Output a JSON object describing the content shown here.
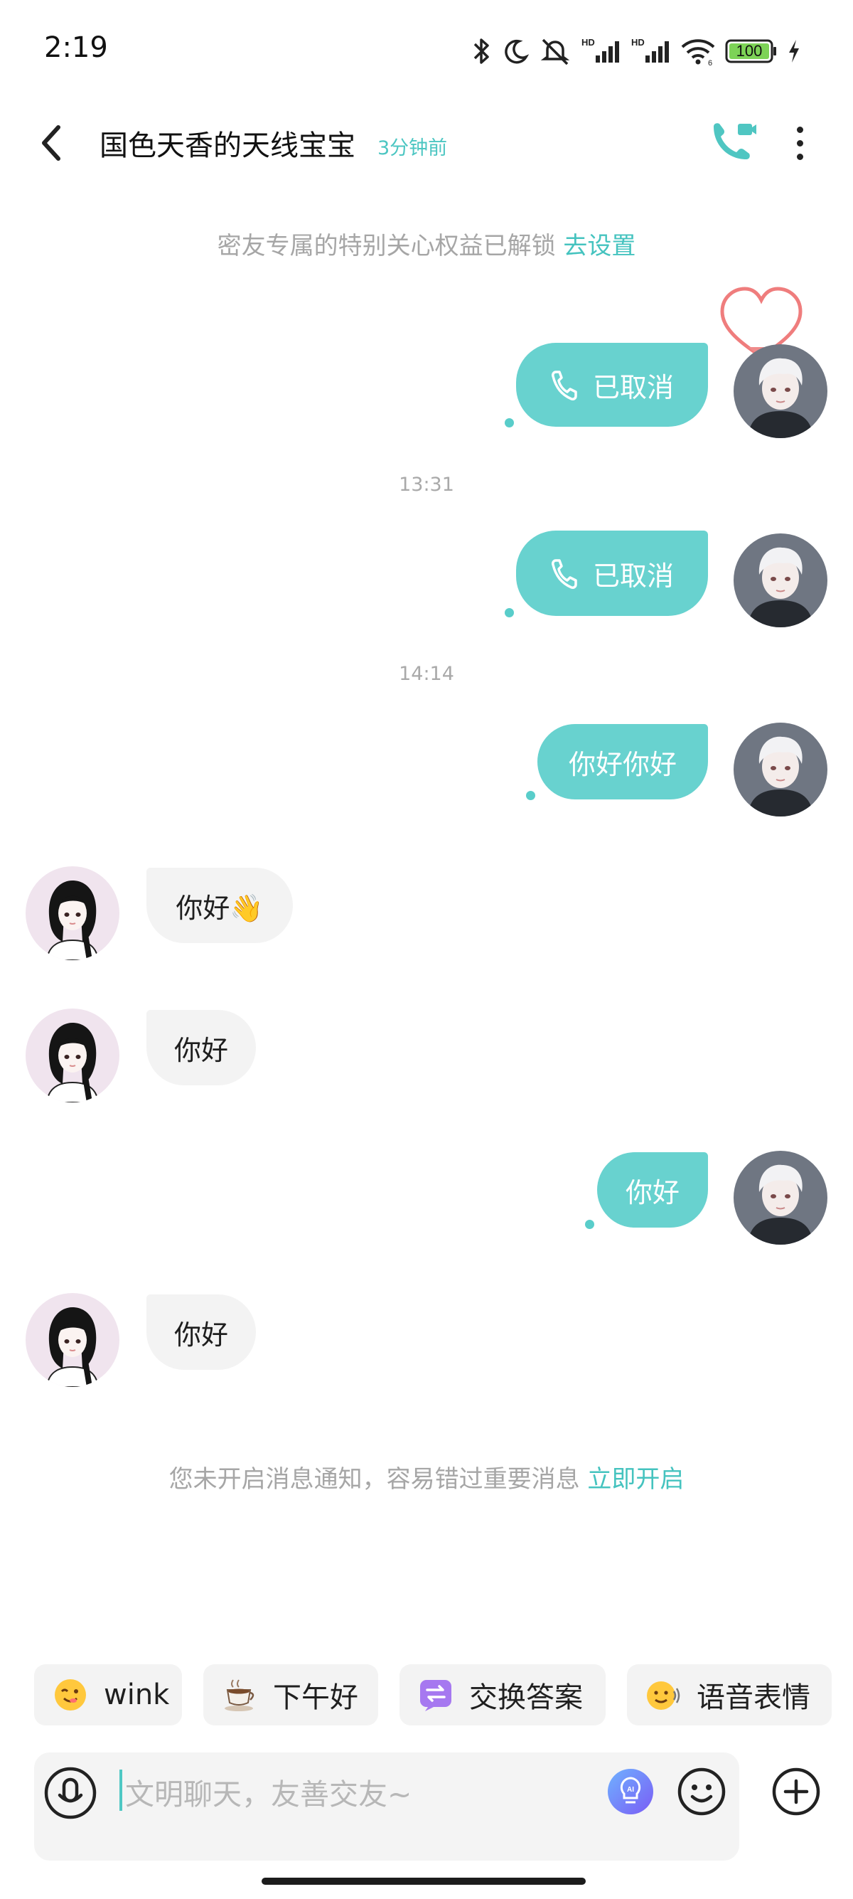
{
  "status_bar": {
    "time": "2:19",
    "battery": "100",
    "icons": [
      "bluetooth-icon",
      "moon-icon",
      "mute-icon",
      "hd-signal-icon",
      "hd-signal-icon",
      "wifi-icon",
      "battery-icon",
      "charging-icon"
    ]
  },
  "header": {
    "title": "国色天香的天线宝宝",
    "last_seen": "3分钟前"
  },
  "notices": {
    "special_care": "密友专属的特别关心权益已解锁",
    "special_care_link": "去设置",
    "notification": "您未开启消息通知，容易错过重要消息",
    "notification_link": "立即开启"
  },
  "messages": [
    {
      "side": "out",
      "type": "call",
      "text": "已取消"
    },
    {
      "type": "time",
      "text": "13:31"
    },
    {
      "side": "out",
      "type": "call",
      "text": "已取消"
    },
    {
      "type": "time",
      "text": "14:14"
    },
    {
      "side": "out",
      "type": "text",
      "text": "你好你好"
    },
    {
      "side": "in",
      "type": "text",
      "text": "你好👋"
    },
    {
      "side": "in",
      "type": "text",
      "text": "你好"
    },
    {
      "side": "out",
      "type": "text",
      "text": "你好"
    },
    {
      "side": "in",
      "type": "text",
      "text": "你好"
    }
  ],
  "quick_replies": [
    {
      "label": "wink",
      "icon": "wink-emoji-icon"
    },
    {
      "label": "下午好",
      "icon": "coffee-icon"
    },
    {
      "label": "交换答案",
      "icon": "exchange-icon"
    },
    {
      "label": "语音表情",
      "icon": "voice-emoji-icon"
    }
  ],
  "input": {
    "placeholder": "文明聊天，友善交友~"
  },
  "colors": {
    "accent": "#68d2cf",
    "link": "#45c3bf",
    "incoming_bubble": "#f3f3f3"
  }
}
